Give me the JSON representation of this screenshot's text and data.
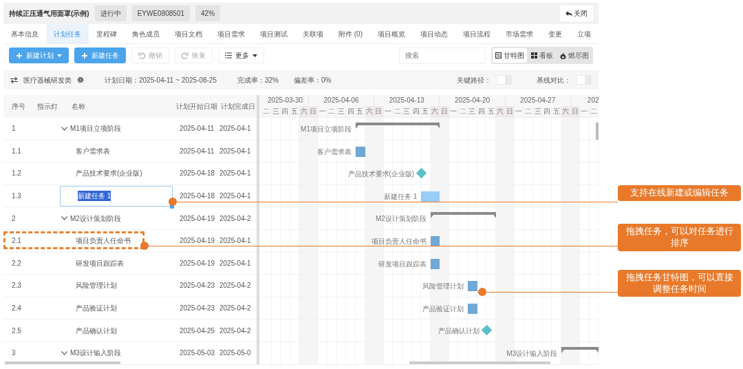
{
  "header": {
    "title": "持续正压通气用面罩(示例)",
    "badges": [
      "进行中",
      "EYWE0808501",
      "42%"
    ],
    "close_button": "关闭"
  },
  "tabs": [
    {
      "label": "基本信息",
      "selected": false
    },
    {
      "label": "计划任务",
      "selected": true
    },
    {
      "label": "里程碑",
      "selected": false
    },
    {
      "label": "角色成员",
      "selected": false
    },
    {
      "label": "项目文档",
      "selected": false
    },
    {
      "label": "项目需求",
      "selected": false
    },
    {
      "label": "项目测试",
      "selected": false
    },
    {
      "label": "关联项",
      "selected": false
    },
    {
      "label": "附件 (0)",
      "selected": false
    },
    {
      "label": "项目概览",
      "selected": false
    },
    {
      "label": "项目动态",
      "selected": false
    },
    {
      "label": "项目流程",
      "selected": false
    },
    {
      "label": "市场需求",
      "selected": false
    },
    {
      "label": "变更",
      "selected": false
    },
    {
      "label": "立项",
      "selected": false
    }
  ],
  "toolbar": {
    "buttons": [
      {
        "label": "新建计划",
        "kind": "primary-dropdown",
        "disabled": false
      },
      {
        "label": "新建任务",
        "kind": "primary",
        "disabled": false
      },
      {
        "label": "撤销",
        "kind": "undo",
        "disabled": true
      },
      {
        "label": "恢复",
        "kind": "redo",
        "disabled": true
      },
      {
        "label": "更多",
        "kind": "menu",
        "disabled": false
      }
    ],
    "search": {
      "placeholder": "搜索"
    },
    "views": [
      {
        "label": "甘特图",
        "kind": "gantt",
        "selected": true
      },
      {
        "label": "看板",
        "kind": "board",
        "selected": false
      },
      {
        "label": "燃尽图",
        "kind": "burndown",
        "selected": false
      }
    ]
  },
  "info_bar": {
    "category": "医疗器械研发类",
    "plan_date": "计划日期：2025-04-11 ~ 2025-08-25",
    "completion": "完成率：32%",
    "deviation": "偏差率：0%",
    "toggles": [
      {
        "label": "关键路径：",
        "on": false
      },
      {
        "label": "基线对比：",
        "on": false
      }
    ]
  },
  "table": {
    "columns": [
      "序号",
      "指示灯",
      "名称",
      "计划开始日期",
      "计划完成日"
    ],
    "rows": [
      {
        "seq": "1",
        "name": "M1项目立项阶段",
        "kind": "summary",
        "expanded": true,
        "start": "2025-04-11",
        "end": "2025-04-1",
        "bar_label": "M1项目立项阶段",
        "editing": false,
        "dragging": false
      },
      {
        "seq": "1.1",
        "name": "客户需求表",
        "kind": "task",
        "start": "2025-04-11",
        "end": "2025-04-1",
        "bar_label": "客户需求表",
        "editing": false,
        "dragging": false
      },
      {
        "seq": "1.2",
        "name": "产品技术要求(企业版)",
        "kind": "milestone",
        "start": "2025-04-18",
        "end": "2025-04-1",
        "bar_label": "产品技术要求(企业版)",
        "editing": false,
        "dragging": false
      },
      {
        "seq": "1.3",
        "name": "新建任务 1",
        "kind": "task",
        "start": "2025-04-18",
        "end": "2025-04-1",
        "bar_label": "新建任务 1",
        "editing": true,
        "dragging": false,
        "callout": {
          "text": "支持在线新建或编辑任务"
        }
      },
      {
        "seq": "2",
        "name": "M2设计策划阶段",
        "kind": "summary",
        "expanded": true,
        "start": "2025-04-19",
        "end": "2025-04-2",
        "bar_label": "M2设计策划阶段",
        "editing": false,
        "dragging": false
      },
      {
        "seq": "2.1",
        "name": "项目负责人任命书",
        "kind": "task",
        "start": "2025-04-19",
        "end": "2025-04-1",
        "bar_label": "项目负责人任命书",
        "editing": false,
        "dragging": true,
        "callout": {
          "text": "拖拽任务，可以对任务进行排序"
        }
      },
      {
        "seq": "2.2",
        "name": "研发项目跟踪表",
        "kind": "task",
        "start": "2025-04-19",
        "end": "2025-04-1",
        "bar_label": "研发项目跟踪表",
        "editing": false,
        "dragging": false
      },
      {
        "seq": "2.3",
        "name": "风险管理计划",
        "kind": "task",
        "start": "2025-04-23",
        "end": "2025-04-2",
        "bar_label": "风险管理计划",
        "editing": false,
        "dragging": false,
        "callout": {
          "text": "拖拽任务甘特图，可以直接调整任务时间"
        }
      },
      {
        "seq": "2.4",
        "name": "产品验证计划",
        "kind": "task",
        "start": "2025-04-23",
        "end": "2025-04-2",
        "bar_label": "产品验证计划",
        "editing": false,
        "dragging": false
      },
      {
        "seq": "2.5",
        "name": "产品确认计划",
        "kind": "milestone",
        "start": "2025-04-25",
        "end": "2025-04-2",
        "bar_label": "产品确认计划",
        "editing": false,
        "dragging": false
      },
      {
        "seq": "3",
        "name": "M3设计输入阶段",
        "kind": "summary",
        "expanded": true,
        "start": "2025-05-03",
        "end": "2025-05-0",
        "bar_label": "M3设计输入阶段",
        "editing": false,
        "dragging": false
      }
    ]
  },
  "gantt": {
    "weeks": [
      {
        "label": "2025-03-30",
        "days": [
          {
            "label": "二",
            "weekend": false
          },
          {
            "label": "三",
            "weekend": false
          },
          {
            "label": "四",
            "weekend": false
          },
          {
            "label": "五",
            "weekend": false
          },
          {
            "label": "六",
            "weekend": true
          }
        ]
      },
      {
        "label": "2025-04-06",
        "days": [
          {
            "label": "日",
            "weekend": true
          },
          {
            "label": "一",
            "weekend": false
          },
          {
            "label": "二",
            "weekend": false
          },
          {
            "label": "三",
            "weekend": false
          },
          {
            "label": "四",
            "weekend": false
          },
          {
            "label": "五",
            "weekend": false
          },
          {
            "label": "六",
            "weekend": true
          }
        ]
      },
      {
        "label": "2025-04-13",
        "days": [
          {
            "label": "日",
            "weekend": true
          },
          {
            "label": "一",
            "weekend": false
          },
          {
            "label": "二",
            "weekend": false
          },
          {
            "label": "三",
            "weekend": false
          },
          {
            "label": "四",
            "weekend": false
          },
          {
            "label": "五",
            "weekend": false
          },
          {
            "label": "六",
            "weekend": true
          }
        ]
      },
      {
        "label": "2025-04-20",
        "days": [
          {
            "label": "日",
            "weekend": true
          },
          {
            "label": "一",
            "weekend": false
          },
          {
            "label": "二",
            "weekend": false
          },
          {
            "label": "三",
            "weekend": false
          },
          {
            "label": "四",
            "weekend": false
          },
          {
            "label": "五",
            "weekend": false
          },
          {
            "label": "六",
            "weekend": true
          }
        ]
      },
      {
        "label": "2025-04-27",
        "days": [
          {
            "label": "日",
            "weekend": true
          },
          {
            "label": "一",
            "weekend": false
          },
          {
            "label": "二",
            "weekend": false
          },
          {
            "label": "三",
            "weekend": false
          },
          {
            "label": "四",
            "weekend": false
          },
          {
            "label": "五",
            "weekend": false
          },
          {
            "label": "六",
            "weekend": true
          }
        ]
      },
      {
        "label": "202",
        "days": [
          {
            "label": "日",
            "weekend": true
          },
          {
            "label": "一",
            "weekend": false
          },
          {
            "label": "二",
            "weekend": false
          }
        ]
      }
    ]
  }
}
